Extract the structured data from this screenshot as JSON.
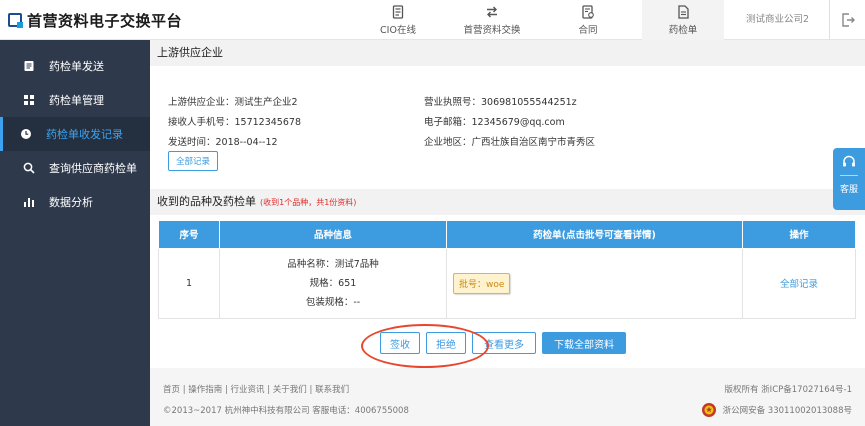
{
  "header": {
    "logo_text": "首营资料电子交换平台",
    "nav": [
      {
        "label": "CIO在线",
        "icon": "document-icon"
      },
      {
        "label": "首营资料交换",
        "icon": "exchange-icon"
      },
      {
        "label": "合同",
        "icon": "contract-icon"
      },
      {
        "label": "药检单",
        "icon": "report-icon",
        "active": true
      }
    ],
    "company": "测试商业公司2",
    "logout_icon": "logout-icon"
  },
  "sidebar": {
    "items": [
      {
        "label": "药检单发送",
        "icon": "send-icon"
      },
      {
        "label": "药检单管理",
        "icon": "grid-icon"
      },
      {
        "label": "药检单收发记录",
        "icon": "clock-icon",
        "active": true
      },
      {
        "label": "查询供应商药检单",
        "icon": "search-icon"
      },
      {
        "label": "数据分析",
        "icon": "bar-chart-icon"
      }
    ]
  },
  "supplier": {
    "title": "上游供应企业",
    "enterprise": "上游供应企业：测试生产企业2",
    "phone": "接收人手机号：15712345678",
    "send_time": "发送时间：2018--04--12",
    "license": "营业执照号：306981055544251z",
    "email": "电子邮箱：12345679@qq.com",
    "region": "企业地区：广西壮族自治区南宁市青秀区",
    "all_records_btn": "全部记录"
  },
  "received": {
    "title": "收到的品种及药检单",
    "note": "(收到1个品种，共1份资料)",
    "columns": [
      "序号",
      "品种信息",
      "药检单(点击批号可查看详情)",
      "操作"
    ],
    "rows": [
      {
        "index": "1",
        "variety_name": "品种名称：测试7品种",
        "spec": "规格：651",
        "package_spec": "包装规格：--",
        "batch": "批号：woe",
        "action": "全部记录"
      }
    ]
  },
  "actions": {
    "sign": "签收",
    "reject": "拒绝",
    "more": "查看更多",
    "download": "下载全部资料"
  },
  "footer": {
    "links": "首页  |  操作指南  |  行业资讯  |  关于我们  |  联系我们",
    "copyright": "©2013~2017 杭州神中科技有限公司   客服电话：4006755008",
    "icp": "版权所有 浙ICP备17027164号-1",
    "police": "浙公网安备 33011002013088号"
  },
  "service": {
    "label": "客服"
  },
  "colors": {
    "accent": "#3d9be0",
    "sidebar_bg": "#2e3a4c",
    "highlight": "#e8472e",
    "note_red": "#e02a2a"
  }
}
